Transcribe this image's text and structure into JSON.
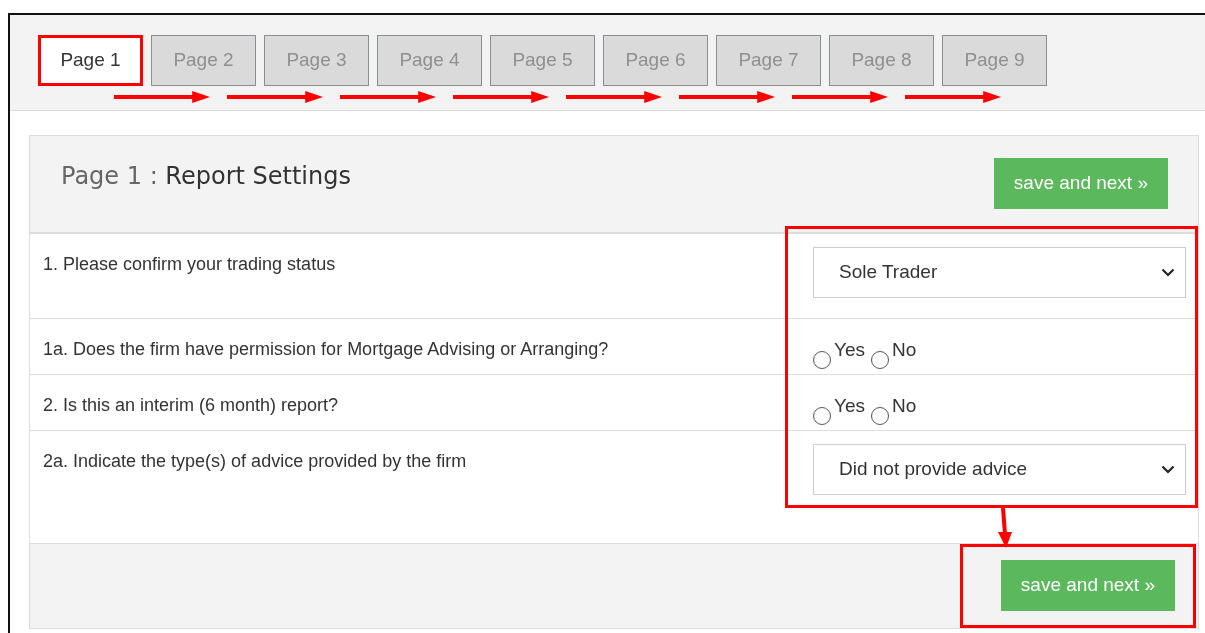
{
  "tabs": [
    {
      "label": "Page 1",
      "selected": true
    },
    {
      "label": "Page 2",
      "selected": false
    },
    {
      "label": "Page 3",
      "selected": false
    },
    {
      "label": "Page 4",
      "selected": false
    },
    {
      "label": "Page 5",
      "selected": false
    },
    {
      "label": "Page 6",
      "selected": false
    },
    {
      "label": "Page 7",
      "selected": false
    },
    {
      "label": "Page 8",
      "selected": false
    },
    {
      "label": "Page 9",
      "selected": false
    }
  ],
  "header": {
    "page_label": "Page 1 :",
    "title": "Report Settings",
    "button": "save and next »"
  },
  "questions": [
    {
      "kind": "select",
      "text": "1. Please confirm your trading status",
      "value": "Sole Trader"
    },
    {
      "kind": "radio",
      "text": "1a. Does the firm have permission for Mortgage Advising or Arranging?",
      "options": [
        {
          "label": "Yes",
          "checked": false
        },
        {
          "label": "No",
          "checked": false
        }
      ]
    },
    {
      "kind": "radio",
      "text": "2. Is this an interim (6 month) report?",
      "options": [
        {
          "label": "Yes",
          "checked": false
        },
        {
          "label": "No",
          "checked": false
        }
      ]
    },
    {
      "kind": "select",
      "text": "2a. Indicate the type(s) of advice provided by the firm",
      "value": "Did not provide advice"
    }
  ],
  "footer": {
    "button": "save and next »"
  }
}
